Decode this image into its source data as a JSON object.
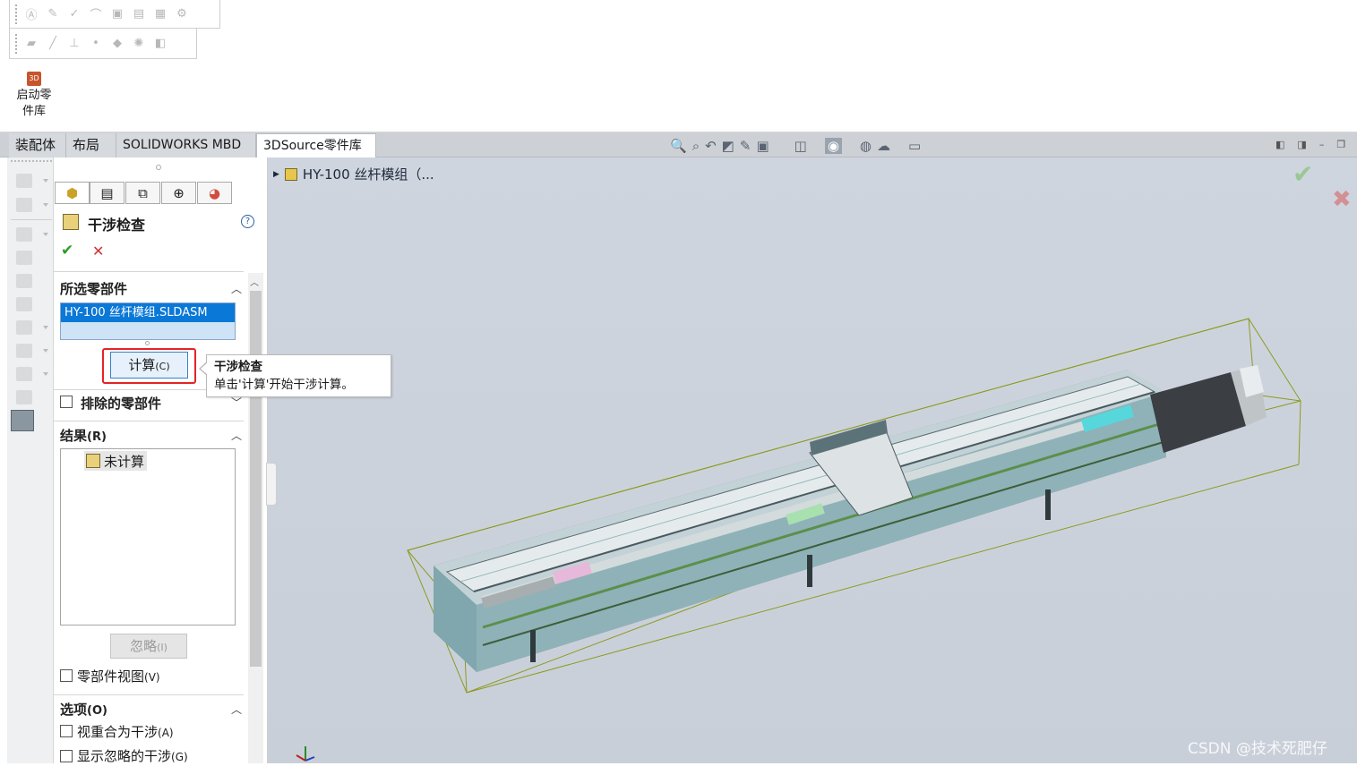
{
  "ribbon": {
    "launch_button_label": "启动零\n件库",
    "launch_icon_text": "3D"
  },
  "tabs": [
    {
      "label": "装配体"
    },
    {
      "label": "布局"
    },
    {
      "label": "SOLIDWORKS MBD"
    },
    {
      "label": "3DSource零件库"
    }
  ],
  "property_manager": {
    "title": "干涉检查",
    "help_icon": "?",
    "ok_icon": "✔",
    "cancel_icon": "✕",
    "selected_components": {
      "heading": "所选零部件",
      "item": "HY-100 丝杆模组.SLDASM"
    },
    "calculate_button": "计算",
    "calculate_shortcut": "(C)",
    "excluded_components": {
      "heading": "排除的零部件"
    },
    "results": {
      "heading": "结果",
      "heading_shortcut": "(R)",
      "item": "未计算",
      "ignore_button": "忽略",
      "ignore_shortcut": "(I)",
      "component_view_label": "零部件视图",
      "component_view_shortcut": "(V)"
    },
    "options": {
      "heading": "选项",
      "heading_shortcut": "(O)",
      "coincident_label": "视重合为干涉",
      "coincident_shortcut": "(A)",
      "show_ignored_label": "显示忽略的干涉",
      "show_ignored_shortcut": "(G)"
    }
  },
  "tooltip": {
    "title": "干涉检查",
    "body": "单击'计算'开始干涉计算。"
  },
  "viewport": {
    "breadcrumb": "HY-100 丝杆模组（...",
    "ok_icon": "✔",
    "cancel_icon": "✖"
  },
  "watermark": "CSDN @技术死肥仔"
}
